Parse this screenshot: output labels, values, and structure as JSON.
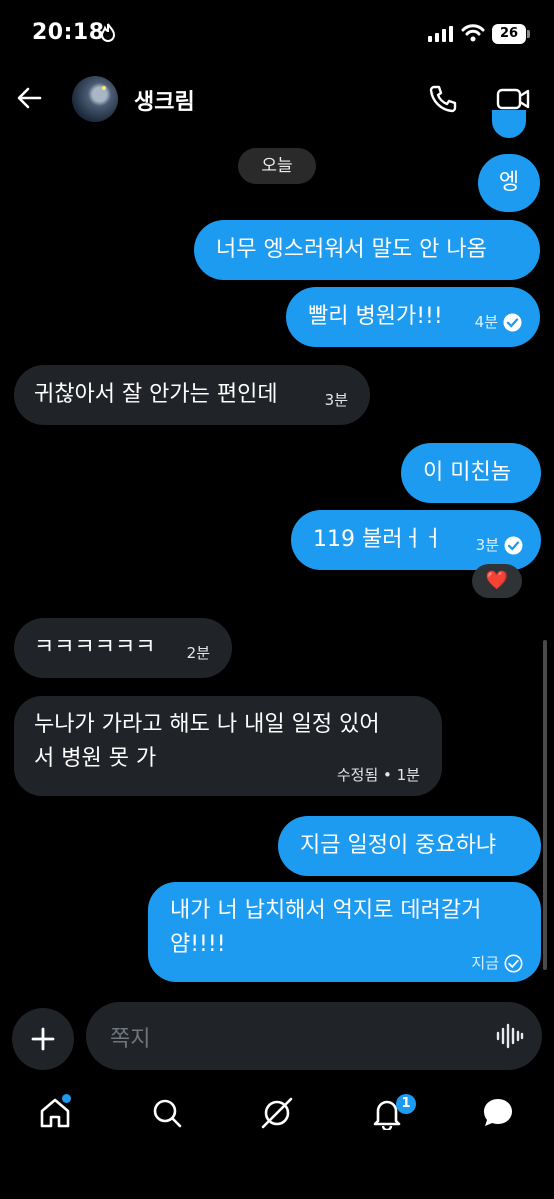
{
  "status": {
    "time": "20:18",
    "battery": "26"
  },
  "header": {
    "contact_name": "생크림"
  },
  "chat": {
    "date_label": "오늘",
    "messages": [
      {
        "from": "me",
        "text": "엥"
      },
      {
        "from": "me",
        "text": "너무 엥스러워서 말도 안 나옴"
      },
      {
        "from": "me",
        "text": "빨리 병원가!!!",
        "time": "4분",
        "read": true
      },
      {
        "from": "them",
        "text": "귀찮아서 잘 안가는 편인데",
        "time": "3분"
      },
      {
        "from": "me",
        "text": "이 미친놈"
      },
      {
        "from": "me",
        "text": "119 불러ㅓㅓ",
        "time": "3분",
        "read": true,
        "reaction": "❤️"
      },
      {
        "from": "them",
        "text": "ㅋㅋㅋㅋㅋㅋ",
        "time": "2분"
      },
      {
        "from": "them",
        "lines": [
          "누나가 가라고 해도 나 내일 일정 있어",
          "서 병원 못 가"
        ],
        "time": "수정됨 • 1분"
      },
      {
        "from": "me",
        "text": "지금 일정이 중요하냐"
      },
      {
        "from": "me",
        "lines": [
          "내가 너 납치해서 억지로 데려갈거",
          "얌!!!!"
        ],
        "time": "지금",
        "read": false
      }
    ]
  },
  "composer": {
    "placeholder": "쪽지"
  },
  "nav": {
    "notification_count": "1",
    "accent": "#1d9bf0"
  }
}
